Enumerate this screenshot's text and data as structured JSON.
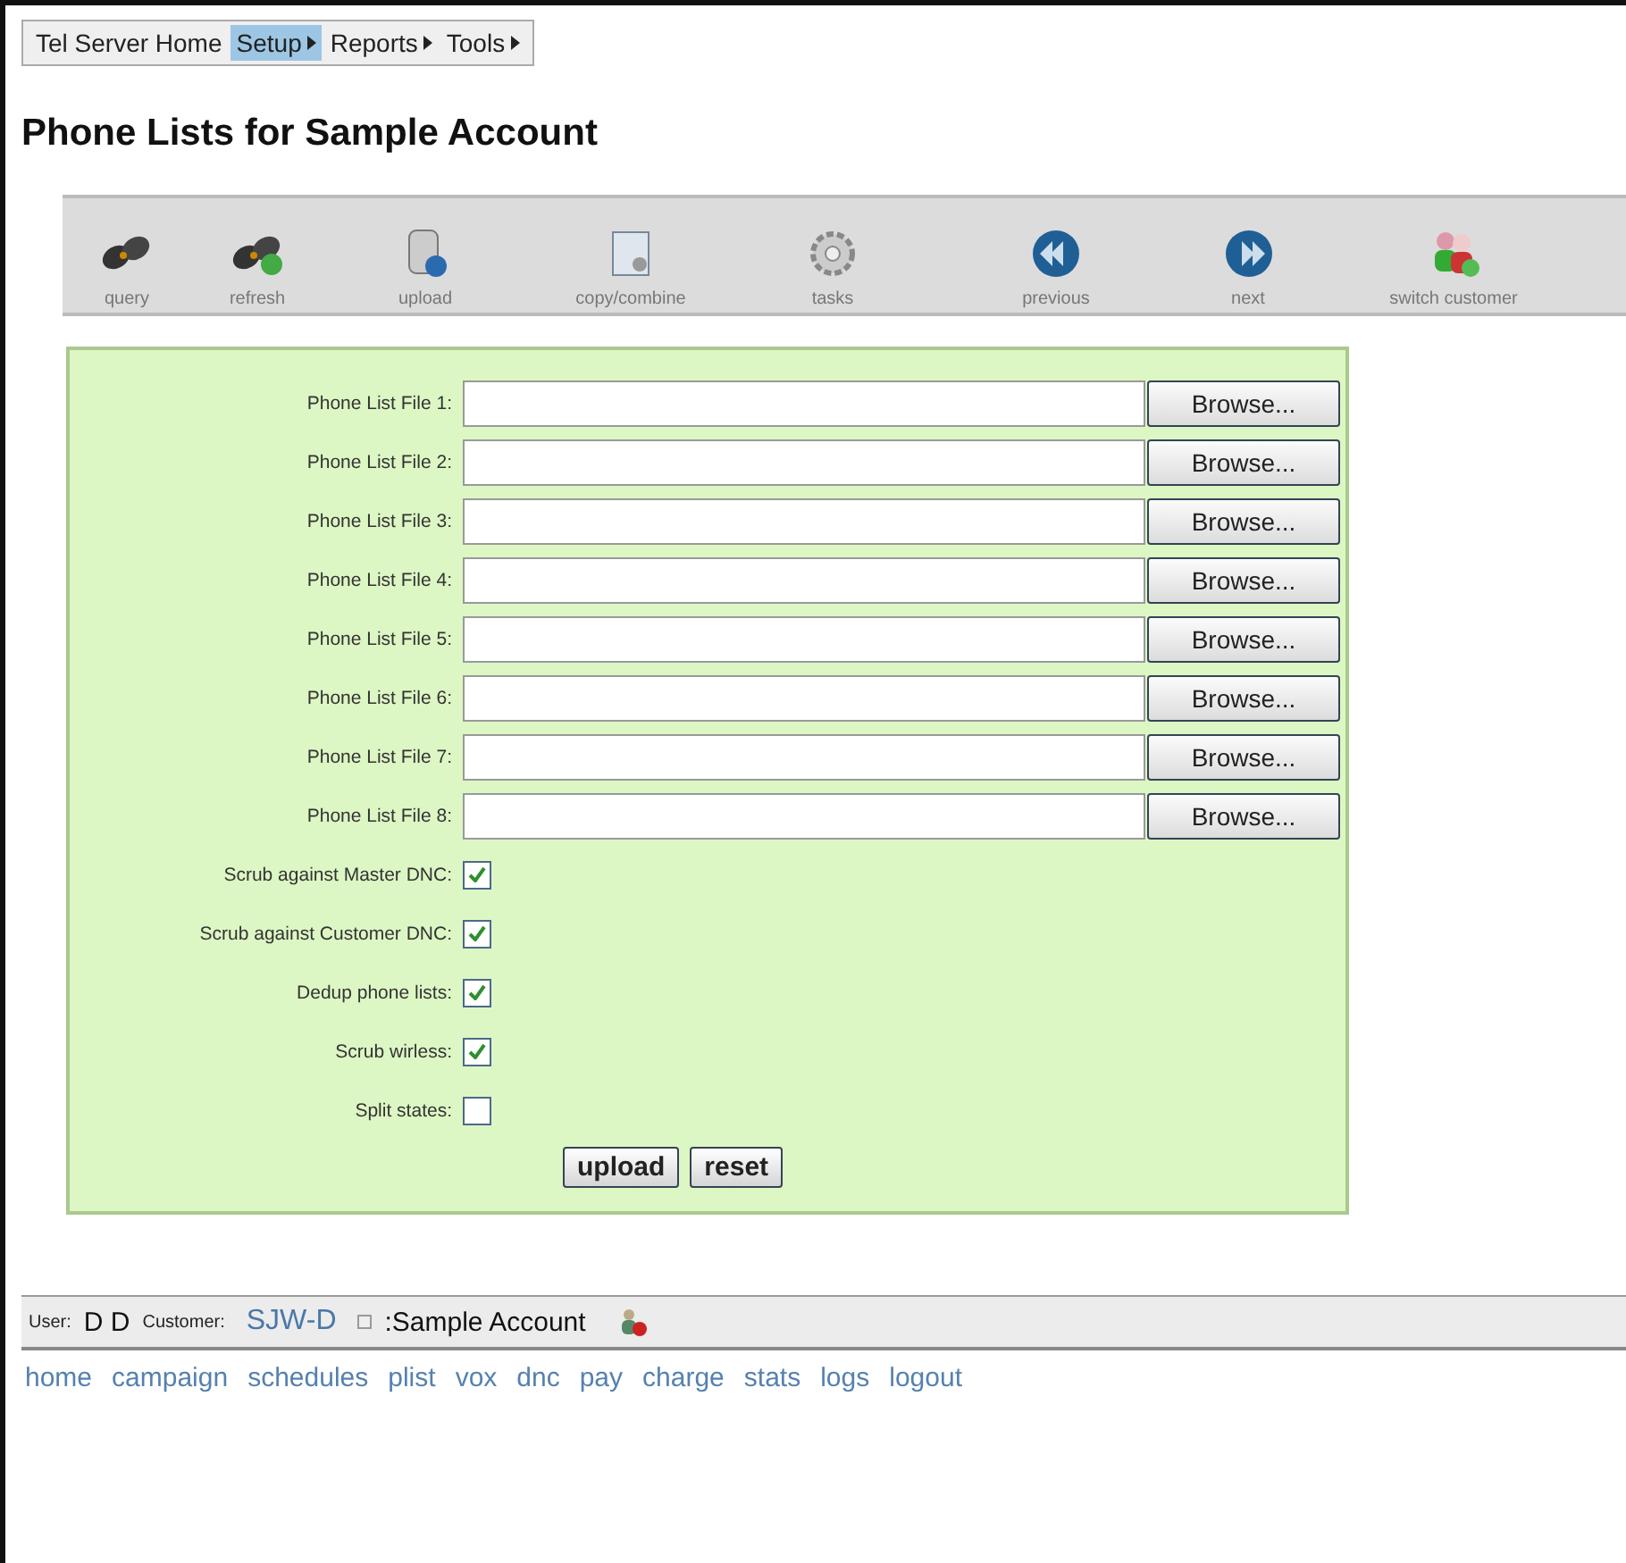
{
  "menu": [
    {
      "label": "Tel Server Home",
      "submenu": false,
      "selected": false
    },
    {
      "label": "Setup",
      "submenu": true,
      "selected": true
    },
    {
      "label": "Reports",
      "submenu": true,
      "selected": false
    },
    {
      "label": "Tools",
      "submenu": true,
      "selected": false
    }
  ],
  "title": "Phone Lists for Sample Account",
  "toolbar": [
    "query",
    "refresh",
    "upload",
    "copy/combine",
    "tasks",
    "previous",
    "next",
    "switch customer"
  ],
  "file_fields": [
    {
      "label": "Phone List File 1:",
      "button": "Browse..."
    },
    {
      "label": "Phone List File 2:",
      "button": "Browse..."
    },
    {
      "label": "Phone List File 3:",
      "button": "Browse..."
    },
    {
      "label": "Phone List File 4:",
      "button": "Browse..."
    },
    {
      "label": "Phone List File 5:",
      "button": "Browse..."
    },
    {
      "label": "Phone List File 6:",
      "button": "Browse..."
    },
    {
      "label": "Phone List File 7:",
      "button": "Browse..."
    },
    {
      "label": "Phone List File 8:",
      "button": "Browse..."
    }
  ],
  "options": [
    {
      "label": "Scrub against Master DNC:",
      "checked": true
    },
    {
      "label": "Scrub against Customer DNC:",
      "checked": true
    },
    {
      "label": "Dedup phone lists:",
      "checked": true
    },
    {
      "label": "Scrub wirless:",
      "checked": true
    },
    {
      "label": "Split states:",
      "checked": false
    }
  ],
  "buttons": [
    "upload",
    "reset"
  ],
  "status_bar": {
    "user_label": "User:",
    "user": "D D",
    "customer_label": "Customer:",
    "customer": "SJW-D",
    "account": ":Sample Account"
  },
  "footer_links": [
    "home",
    "campaign",
    "schedules",
    "plist",
    "vox",
    "dnc",
    "pay",
    "charge",
    "stats",
    "logs",
    "logout"
  ]
}
